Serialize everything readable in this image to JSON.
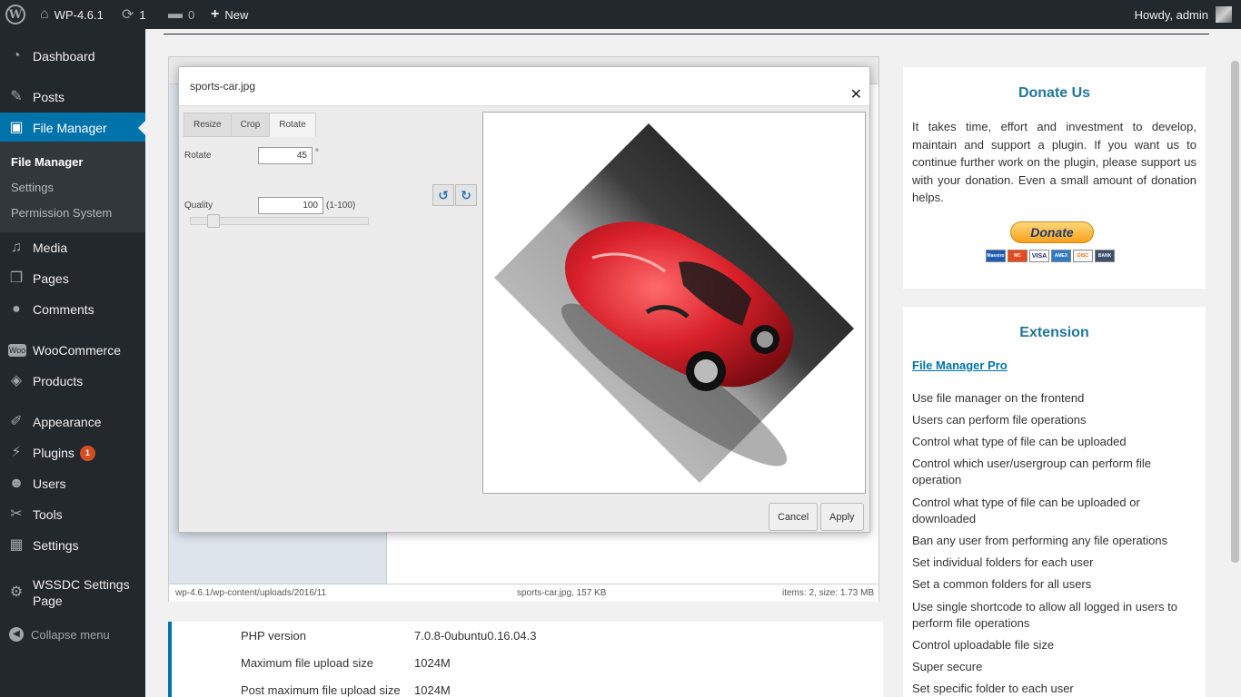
{
  "admin_bar": {
    "site_name": "WP-4.6.1",
    "updates_count": "1",
    "comments_count": "0",
    "new_label": "New",
    "howdy": "Howdy, admin"
  },
  "sidebar": {
    "items": [
      {
        "label": "Dashboard",
        "icon": "dashboard-icon"
      },
      {
        "label": "Posts",
        "icon": "pin-icon"
      },
      {
        "label": "File Manager",
        "icon": "file-manager-icon",
        "active": true
      },
      {
        "label": "Media",
        "icon": "media-icon"
      },
      {
        "label": "Pages",
        "icon": "pages-icon"
      },
      {
        "label": "Comments",
        "icon": "comments-icon"
      },
      {
        "label": "WooCommerce",
        "icon": "woocommerce-icon"
      },
      {
        "label": "Products",
        "icon": "products-icon"
      },
      {
        "label": "Appearance",
        "icon": "appearance-icon"
      },
      {
        "label": "Plugins",
        "icon": "plugins-icon",
        "badge": "1"
      },
      {
        "label": "Users",
        "icon": "users-icon"
      },
      {
        "label": "Tools",
        "icon": "tools-icon"
      },
      {
        "label": "Settings",
        "icon": "settings-icon"
      },
      {
        "label": "WSSDC Settings Page",
        "icon": "gear-icon"
      }
    ],
    "submenu": [
      "File Manager",
      "Settings",
      "Permission System"
    ],
    "collapse_label": "Collapse menu"
  },
  "dialog": {
    "title": "sports-car.jpg",
    "tabs": [
      "Resize",
      "Crop",
      "Rotate"
    ],
    "active_tab": "Rotate",
    "rotate_label": "Rotate",
    "rotate_value": "45",
    "rotate_unit": "°",
    "quality_label": "Quality",
    "quality_value": "100",
    "quality_range": "(1-100)",
    "cancel_label": "Cancel",
    "apply_label": "Apply"
  },
  "status_bar": {
    "path": "wp-4.6.1/wp-content/uploads/2016/11",
    "file": "sports-car.jpg, 157 KB",
    "summary": "items: 2, size: 1.73 MB"
  },
  "server_info": [
    {
      "label": "PHP version",
      "value": "7.0.8-0ubuntu0.16.04.3"
    },
    {
      "label": "Maximum file upload size",
      "value": "1024M"
    },
    {
      "label": "Post maximum file upload size",
      "value": "1024M"
    }
  ],
  "donate": {
    "title": "Donate Us",
    "text": "It takes time, effort and investment to develop, maintain and support a plugin. If you want us to continue further work on the plugin, please support us with your donation. Even a small amount of donation helps.",
    "button": "Donate",
    "cards": [
      "Maestro",
      "MC",
      "VISA",
      "AMEX",
      "DISC",
      "BANK"
    ]
  },
  "extension": {
    "title": "Extension",
    "link": "File Manager Pro",
    "features": [
      "Use file manager on the frontend",
      "Users can perform file operations",
      "Control what type of file can be uploaded",
      "Control which user/usergroup can perform file operation",
      "Control what type of file can be uploaded or downloaded",
      "Ban any user from performing any file operations",
      "Set individual folders for each user",
      "Set a common folders for all users",
      "Use single shortcode to allow all logged in users to perform file operations",
      "Control uploadable file size",
      "Super secure",
      "Set specific folder to each user"
    ]
  },
  "colors": {
    "accent": "#0073aa",
    "sidebar_bg": "#23282d",
    "title_blue": "#21759b"
  }
}
